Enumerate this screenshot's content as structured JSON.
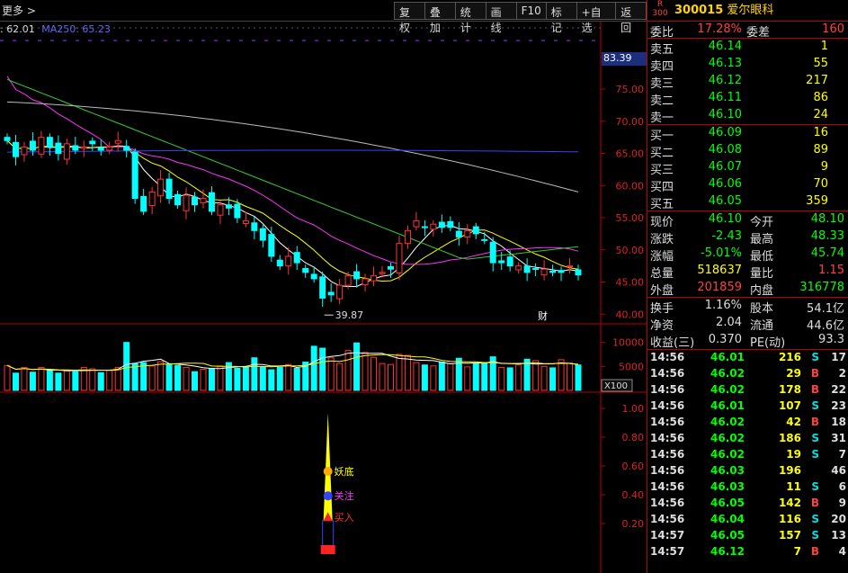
{
  "toolbar": {
    "more": "更多",
    "buttons": [
      "复权",
      "叠加",
      "统计",
      "画线",
      "F10",
      "标记",
      "+自选",
      "返回"
    ]
  },
  "ma_legend": [
    {
      "text": ": 62.01",
      "color": "#dddddd"
    },
    {
      "text": "MA250: 65.23",
      "color": "#6666ff"
    }
  ],
  "price_box": "83.39",
  "price_axis": [
    "80.00",
    "75.00",
    "70.00",
    "65.00",
    "60.00",
    "55.00",
    "50.00",
    "45.00",
    "40.00"
  ],
  "low_label": "39.87",
  "cai_label": "财",
  "vol_axis": [
    "10000",
    "5000"
  ],
  "vol_unit": "X100",
  "ind_axis": [
    "1.00",
    "0.80",
    "0.60",
    "0.40",
    "0.20"
  ],
  "signals": {
    "yaodi": "妖底",
    "guanzhu": "关注",
    "mairu": "买入"
  },
  "stock": {
    "badge_top": "R",
    "badge_bottom": "300",
    "code": "300015",
    "name": "爱尔眼科"
  },
  "weibi": {
    "label1": "委比",
    "value1": "17.28%",
    "label2": "委差",
    "value2": "160"
  },
  "asks": [
    {
      "label": "卖五",
      "price": "46.14",
      "vol": "1"
    },
    {
      "label": "卖四",
      "price": "46.13",
      "vol": "55"
    },
    {
      "label": "卖三",
      "price": "46.12",
      "vol": "217"
    },
    {
      "label": "卖二",
      "price": "46.11",
      "vol": "86"
    },
    {
      "label": "卖一",
      "price": "46.10",
      "vol": "24"
    }
  ],
  "bids": [
    {
      "label": "买一",
      "price": "46.09",
      "vol": "16"
    },
    {
      "label": "买二",
      "price": "46.08",
      "vol": "89"
    },
    {
      "label": "买三",
      "price": "46.07",
      "vol": "9"
    },
    {
      "label": "买四",
      "price": "46.06",
      "vol": "70"
    },
    {
      "label": "买五",
      "price": "46.05",
      "vol": "359"
    }
  ],
  "quote": [
    {
      "l1": "现价",
      "v1": "46.10",
      "c1": "g",
      "l2": "今开",
      "v2": "48.10",
      "c2": "g"
    },
    {
      "l1": "涨跌",
      "v1": "-2.43",
      "c1": "g",
      "l2": "最高",
      "v2": "48.33",
      "c2": "g"
    },
    {
      "l1": "涨幅",
      "v1": "-5.01%",
      "c1": "g",
      "l2": "最低",
      "v2": "45.74",
      "c2": "g"
    },
    {
      "l1": "总量",
      "v1": "518637",
      "c1": "y",
      "l2": "量比",
      "v2": "1.15",
      "c2": "r"
    },
    {
      "l1": "外盘",
      "v1": "201859",
      "c1": "r",
      "l2": "内盘",
      "v2": "316778",
      "c2": "g"
    }
  ],
  "fund": [
    {
      "l1": "换手",
      "v1": "1.16%",
      "l2": "股本",
      "v2": "54.1亿"
    },
    {
      "l1": "净资",
      "v1": "2.04",
      "l2": "流通",
      "v2": "44.6亿"
    },
    {
      "l1": "收益(三)",
      "v1": "0.370",
      "l2": "PE(动)",
      "v2": "93.3"
    }
  ],
  "trades": [
    {
      "t": "14:56",
      "p": "46.01",
      "v": "216",
      "s": "S",
      "n": "17"
    },
    {
      "t": "14:56",
      "p": "46.02",
      "v": "29",
      "s": "B",
      "n": "2"
    },
    {
      "t": "14:56",
      "p": "46.02",
      "v": "178",
      "s": "B",
      "n": "22"
    },
    {
      "t": "14:56",
      "p": "46.01",
      "v": "107",
      "s": "S",
      "n": "23"
    },
    {
      "t": "14:56",
      "p": "46.02",
      "v": "42",
      "s": "B",
      "n": "18"
    },
    {
      "t": "14:56",
      "p": "46.02",
      "v": "186",
      "s": "S",
      "n": "31"
    },
    {
      "t": "14:56",
      "p": "46.02",
      "v": "19",
      "s": "S",
      "n": "7"
    },
    {
      "t": "14:56",
      "p": "46.03",
      "v": "196",
      "s": "",
      "n": "46"
    },
    {
      "t": "14:56",
      "p": "46.03",
      "v": "11",
      "s": "S",
      "n": "6"
    },
    {
      "t": "14:56",
      "p": "46.05",
      "v": "142",
      "s": "B",
      "n": "9"
    },
    {
      "t": "14:56",
      "p": "46.04",
      "v": "116",
      "s": "S",
      "n": "20"
    },
    {
      "t": "14:57",
      "p": "46.05",
      "v": "157",
      "s": "S",
      "n": "13"
    },
    {
      "t": "14:57",
      "p": "46.12",
      "v": "7",
      "s": "B",
      "n": "4"
    }
  ],
  "chart_data": {
    "type": "candlestick",
    "y_range": [
      38.5,
      85.5
    ],
    "closes": [
      67,
      64.5,
      66,
      65.5,
      67.5,
      66,
      65,
      66.5,
      65.5,
      66,
      66.5,
      65.5,
      66,
      67,
      65.5,
      58,
      56,
      59,
      61,
      58,
      57,
      58.5,
      57,
      58,
      56,
      57,
      56.5,
      55,
      54.5,
      53,
      51.5,
      49,
      47.5,
      49,
      48,
      46.5,
      45.5,
      42.5,
      43,
      44.5,
      46,
      45.5,
      45.5,
      46,
      46.5,
      47,
      51,
      53,
      54.5,
      53.5,
      54,
      53.5,
      53.5,
      52,
      53,
      52.5,
      51.5,
      48,
      48,
      47.5,
      47.5,
      46.5,
      47,
      47,
      46.5,
      46.5,
      47.5,
      46.1
    ],
    "volumes": [
      5200,
      3600,
      4800,
      3800,
      4800,
      4200,
      3600,
      4100,
      3900,
      4800,
      4500,
      3700,
      4200,
      4800,
      10000,
      5600,
      5800,
      5100,
      6000,
      5400,
      5200,
      4800,
      3900,
      4400,
      4600,
      5100,
      5800,
      4600,
      4900,
      6800,
      4800,
      4300,
      4800,
      5400,
      4600,
      5900,
      9200,
      8800,
      6800,
      5600,
      8300,
      9900,
      7900,
      6900,
      5600,
      5400,
      7500,
      7300,
      5800,
      5300,
      5100,
      5900,
      5600,
      6700,
      4900,
      5600,
      5800,
      7000,
      4800,
      4700,
      5300,
      6500,
      6200,
      5000,
      4700,
      6400,
      5700,
      5300
    ],
    "indicator_peak": 0.97
  }
}
